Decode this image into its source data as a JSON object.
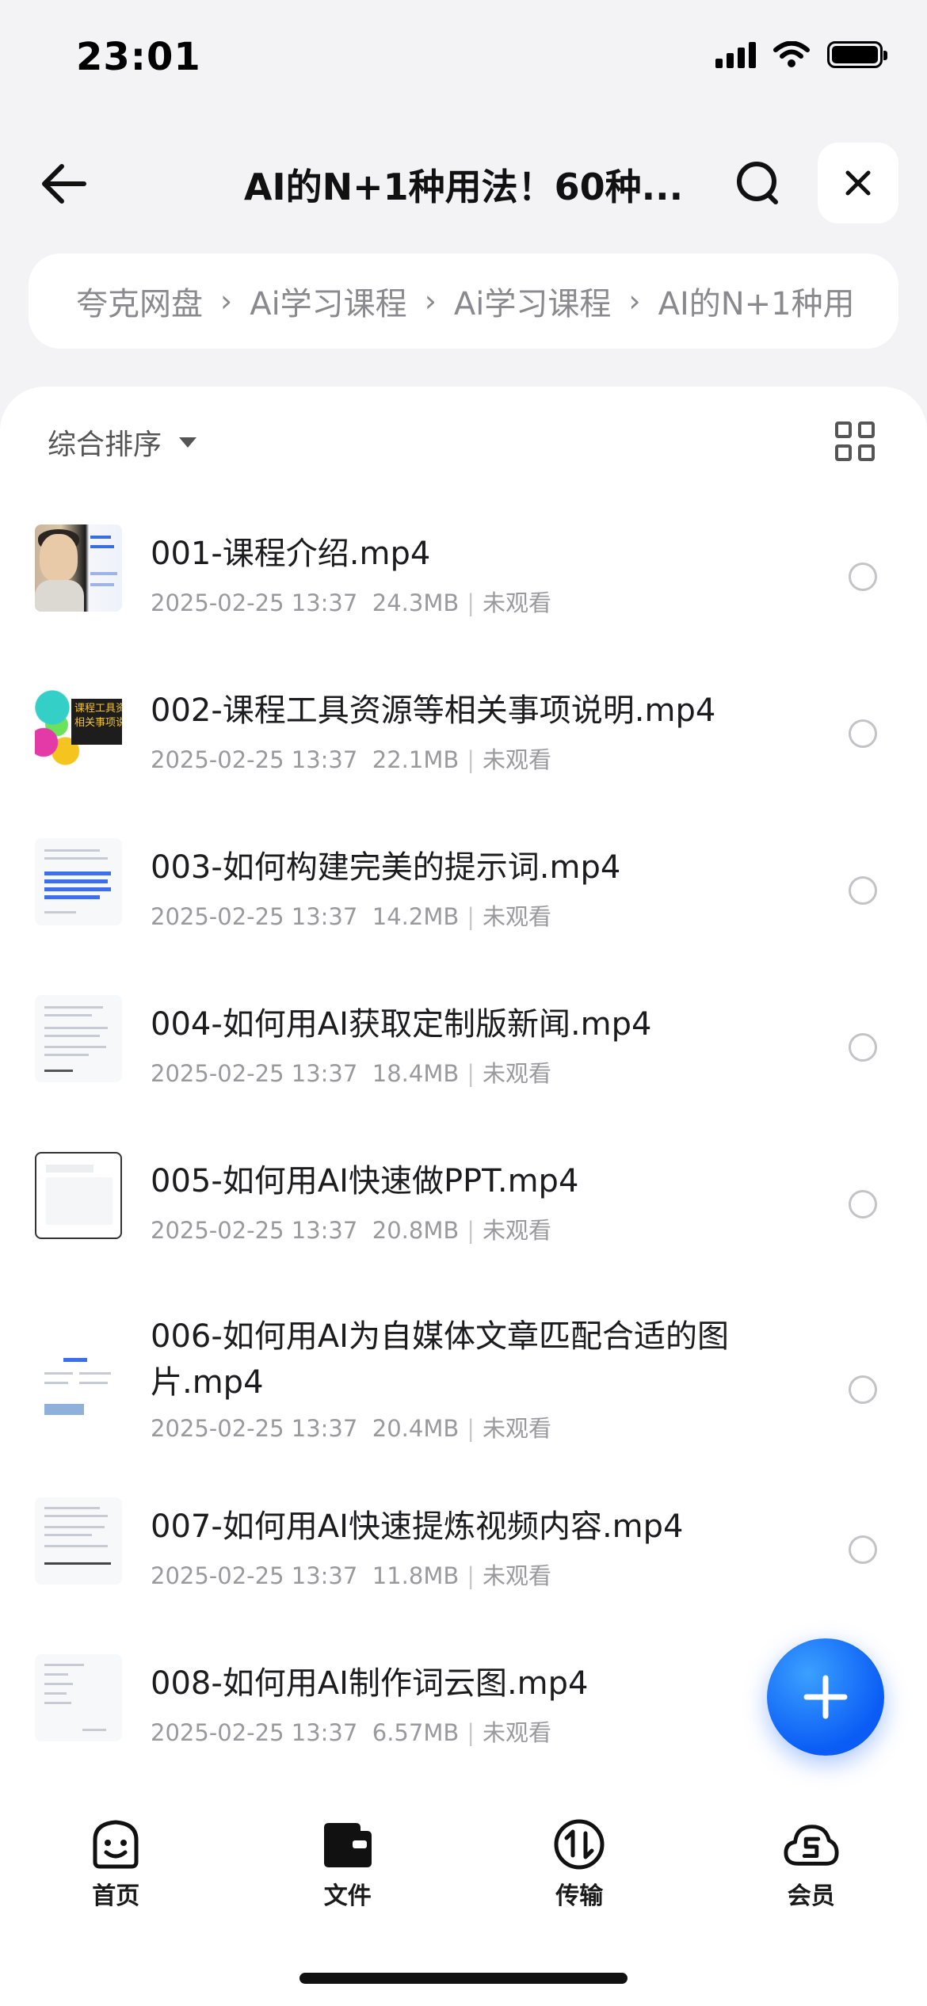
{
  "status_bar": {
    "time": "23:01"
  },
  "nav": {
    "title": "AI的N+1种用法！60种..."
  },
  "breadcrumb": [
    "夸克网盘",
    "Ai学习课程",
    "Ai学习课程",
    "AI的N+1种用"
  ],
  "toolbar": {
    "sort_label": "综合排序"
  },
  "files": [
    {
      "name": "001-课程介绍.mp4",
      "date": "2025-02-25 13:37",
      "size": "24.3MB",
      "status": "未观看",
      "thumb": "person"
    },
    {
      "name": "002-课程工具资源等相关事项说明.mp4",
      "date": "2025-02-25 13:37",
      "size": "22.1MB",
      "status": "未观看",
      "thumb": "board",
      "thumb_text": "课程工具资\n相关事项说"
    },
    {
      "name": "003-如何构建完美的提示词.mp4",
      "date": "2025-02-25 13:37",
      "size": "14.2MB",
      "status": "未观看",
      "thumb": "doc"
    },
    {
      "name": "004-如何用AI获取定制版新闻.mp4",
      "date": "2025-02-25 13:37",
      "size": "18.4MB",
      "status": "未观看",
      "thumb": "doc"
    },
    {
      "name": "005-如何用AI快速做PPT.mp4",
      "date": "2025-02-25 13:37",
      "size": "20.8MB",
      "status": "未观看",
      "thumb": "doc"
    },
    {
      "name": "006-如何用AI为自媒体文章匹配合适的图片.mp4",
      "date": "2025-02-25 13:37",
      "size": "20.4MB",
      "status": "未观看",
      "thumb": "doc"
    },
    {
      "name": "007-如何用AI快速提炼视频内容.mp4",
      "date": "2025-02-25 13:37",
      "size": "11.8MB",
      "status": "未观看",
      "thumb": "doc"
    },
    {
      "name": "008-如何用AI制作词云图.mp4",
      "date": "2025-02-25 13:37",
      "size": "6.57MB",
      "status": "未观看",
      "thumb": "doc"
    }
  ],
  "tabs": [
    {
      "label": "首页",
      "icon": "home-face-icon"
    },
    {
      "label": "文件",
      "icon": "folder-icon"
    },
    {
      "label": "传输",
      "icon": "transfer-icon"
    },
    {
      "label": "会员",
      "icon": "cloud-icon"
    }
  ],
  "colors": {
    "accent": "#0a5cf5",
    "background": "#f3f3f5"
  }
}
